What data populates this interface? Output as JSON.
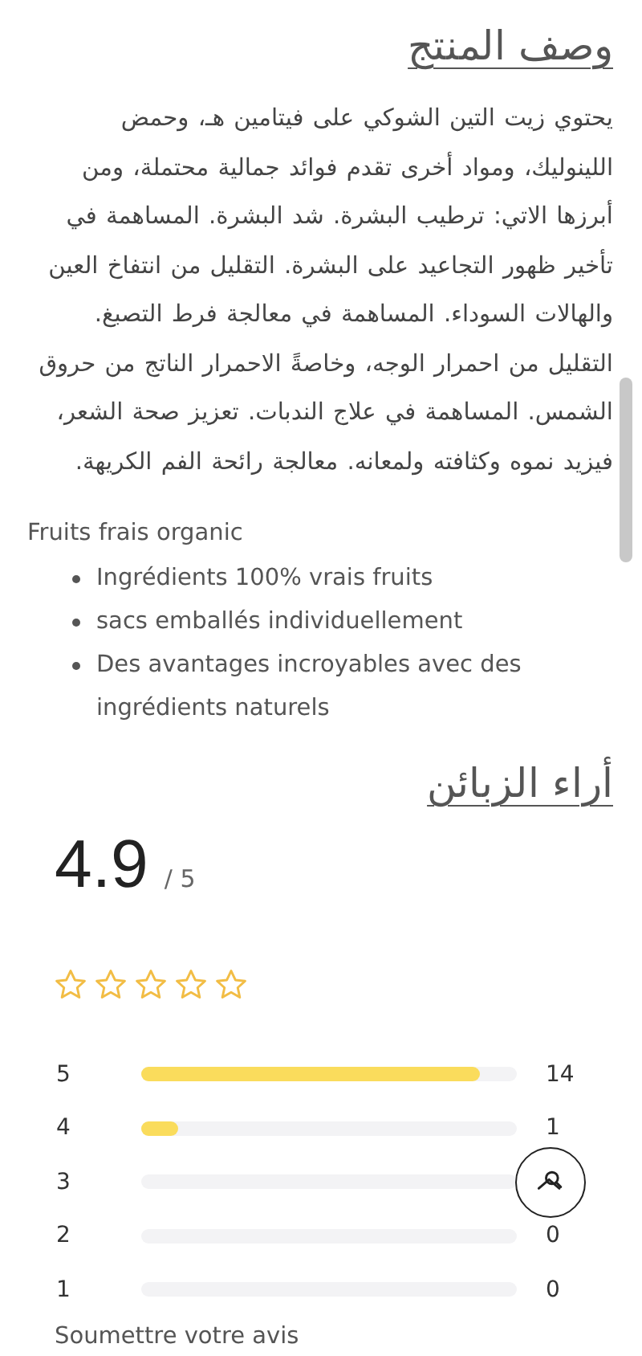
{
  "description": {
    "title": "وصف المنتج",
    "paragraph": "يحتوي زيت التين الشوكي على فيتامين هـ، وحمض اللينوليك، ومواد أخرى تقدم فوائد جمالية محتملة، ومن أبرزها الاتي: ترطيب البشرة. شد البشرة. المساهمة في تأخير ظهور التجاعيد على البشرة. التقليل من انتفاخ العين والهالات السوداء. المساهمة في معالجة فرط التصبغ. التقليل من احمرار الوجه، وخاصةً الاحمرار الناتج من حروق الشمس. المساهمة في علاج الندبات. تعزيز صحة الشعر، فيزيد نموه وكثافته ولمعانه. معالجة رائحة الفم الكريهة.",
    "subtitle": "Fruits frais organic",
    "bullets": [
      "Ingrédients 100% vrais fruits",
      "sacs emballés individuellement",
      "Des avantages incroyables avec des ingrédients naturels"
    ]
  },
  "reviews": {
    "title": "أراء الزبائن",
    "score": "4.9",
    "out_of": "/ 5",
    "stars": 0,
    "breakdown": [
      {
        "label": "5",
        "level": 0.9,
        "count": "14"
      },
      {
        "label": "4",
        "level": 0.1,
        "count": "1"
      },
      {
        "label": "3"
      },
      {
        "label": "2",
        "count": "0"
      },
      {
        "label": "1",
        "count": "0"
      }
    ],
    "submit_link": "Soumettre votre avis"
  }
}
